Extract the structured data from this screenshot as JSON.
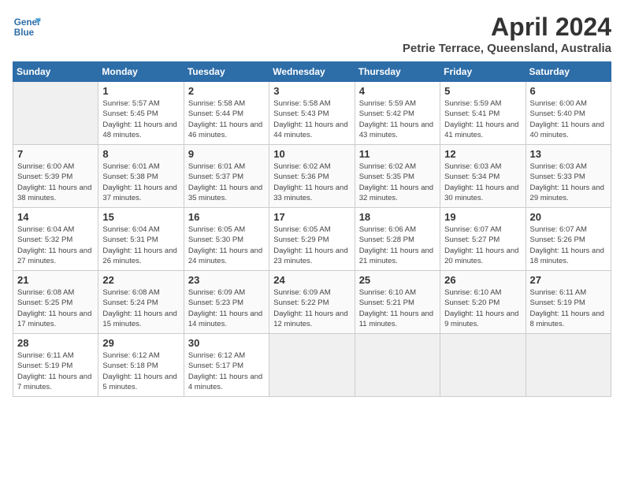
{
  "header": {
    "logo_line1": "General",
    "logo_line2": "Blue",
    "month_year": "April 2024",
    "location": "Petrie Terrace, Queensland, Australia"
  },
  "weekdays": [
    "Sunday",
    "Monday",
    "Tuesday",
    "Wednesday",
    "Thursday",
    "Friday",
    "Saturday"
  ],
  "weeks": [
    [
      {
        "day": "",
        "empty": true
      },
      {
        "day": "1",
        "sunrise": "5:57 AM",
        "sunset": "5:45 PM",
        "daylight": "11 hours and 48 minutes."
      },
      {
        "day": "2",
        "sunrise": "5:58 AM",
        "sunset": "5:44 PM",
        "daylight": "11 hours and 46 minutes."
      },
      {
        "day": "3",
        "sunrise": "5:58 AM",
        "sunset": "5:43 PM",
        "daylight": "11 hours and 44 minutes."
      },
      {
        "day": "4",
        "sunrise": "5:59 AM",
        "sunset": "5:42 PM",
        "daylight": "11 hours and 43 minutes."
      },
      {
        "day": "5",
        "sunrise": "5:59 AM",
        "sunset": "5:41 PM",
        "daylight": "11 hours and 41 minutes."
      },
      {
        "day": "6",
        "sunrise": "6:00 AM",
        "sunset": "5:40 PM",
        "daylight": "11 hours and 40 minutes."
      }
    ],
    [
      {
        "day": "7",
        "sunrise": "6:00 AM",
        "sunset": "5:39 PM",
        "daylight": "11 hours and 38 minutes."
      },
      {
        "day": "8",
        "sunrise": "6:01 AM",
        "sunset": "5:38 PM",
        "daylight": "11 hours and 37 minutes."
      },
      {
        "day": "9",
        "sunrise": "6:01 AM",
        "sunset": "5:37 PM",
        "daylight": "11 hours and 35 minutes."
      },
      {
        "day": "10",
        "sunrise": "6:02 AM",
        "sunset": "5:36 PM",
        "daylight": "11 hours and 33 minutes."
      },
      {
        "day": "11",
        "sunrise": "6:02 AM",
        "sunset": "5:35 PM",
        "daylight": "11 hours and 32 minutes."
      },
      {
        "day": "12",
        "sunrise": "6:03 AM",
        "sunset": "5:34 PM",
        "daylight": "11 hours and 30 minutes."
      },
      {
        "day": "13",
        "sunrise": "6:03 AM",
        "sunset": "5:33 PM",
        "daylight": "11 hours and 29 minutes."
      }
    ],
    [
      {
        "day": "14",
        "sunrise": "6:04 AM",
        "sunset": "5:32 PM",
        "daylight": "11 hours and 27 minutes."
      },
      {
        "day": "15",
        "sunrise": "6:04 AM",
        "sunset": "5:31 PM",
        "daylight": "11 hours and 26 minutes."
      },
      {
        "day": "16",
        "sunrise": "6:05 AM",
        "sunset": "5:30 PM",
        "daylight": "11 hours and 24 minutes."
      },
      {
        "day": "17",
        "sunrise": "6:05 AM",
        "sunset": "5:29 PM",
        "daylight": "11 hours and 23 minutes."
      },
      {
        "day": "18",
        "sunrise": "6:06 AM",
        "sunset": "5:28 PM",
        "daylight": "11 hours and 21 minutes."
      },
      {
        "day": "19",
        "sunrise": "6:07 AM",
        "sunset": "5:27 PM",
        "daylight": "11 hours and 20 minutes."
      },
      {
        "day": "20",
        "sunrise": "6:07 AM",
        "sunset": "5:26 PM",
        "daylight": "11 hours and 18 minutes."
      }
    ],
    [
      {
        "day": "21",
        "sunrise": "6:08 AM",
        "sunset": "5:25 PM",
        "daylight": "11 hours and 17 minutes."
      },
      {
        "day": "22",
        "sunrise": "6:08 AM",
        "sunset": "5:24 PM",
        "daylight": "11 hours and 15 minutes."
      },
      {
        "day": "23",
        "sunrise": "6:09 AM",
        "sunset": "5:23 PM",
        "daylight": "11 hours and 14 minutes."
      },
      {
        "day": "24",
        "sunrise": "6:09 AM",
        "sunset": "5:22 PM",
        "daylight": "11 hours and 12 minutes."
      },
      {
        "day": "25",
        "sunrise": "6:10 AM",
        "sunset": "5:21 PM",
        "daylight": "11 hours and 11 minutes."
      },
      {
        "day": "26",
        "sunrise": "6:10 AM",
        "sunset": "5:20 PM",
        "daylight": "11 hours and 9 minutes."
      },
      {
        "day": "27",
        "sunrise": "6:11 AM",
        "sunset": "5:19 PM",
        "daylight": "11 hours and 8 minutes."
      }
    ],
    [
      {
        "day": "28",
        "sunrise": "6:11 AM",
        "sunset": "5:19 PM",
        "daylight": "11 hours and 7 minutes."
      },
      {
        "day": "29",
        "sunrise": "6:12 AM",
        "sunset": "5:18 PM",
        "daylight": "11 hours and 5 minutes."
      },
      {
        "day": "30",
        "sunrise": "6:12 AM",
        "sunset": "5:17 PM",
        "daylight": "11 hours and 4 minutes."
      },
      {
        "day": "",
        "empty": true
      },
      {
        "day": "",
        "empty": true
      },
      {
        "day": "",
        "empty": true
      },
      {
        "day": "",
        "empty": true
      }
    ]
  ]
}
